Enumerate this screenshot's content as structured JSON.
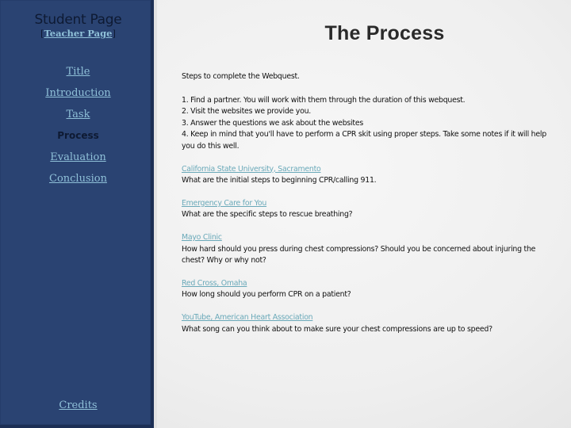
{
  "sidebar": {
    "title": "Student Page",
    "teacher_bracket_open": "[",
    "teacher_link": "Teacher Page",
    "teacher_bracket_close": "]",
    "nav": [
      {
        "label": "Title",
        "current": false
      },
      {
        "label": "Introduction",
        "current": false
      },
      {
        "label": "Task",
        "current": false
      },
      {
        "label": "Process",
        "current": true
      },
      {
        "label": "Evaluation",
        "current": false
      },
      {
        "label": "Conclusion",
        "current": false
      }
    ],
    "credits": "Credits"
  },
  "main": {
    "title": "The Process",
    "intro": "Steps to complete the Webquest.",
    "steps": [
      "1. Find a partner.  You will work with them through the duration of this webquest.",
      "2. Visit the websites we provide you.",
      "3. Answer the questions we ask about the websites",
      "4. Keep in mind that you'll have to perform a CPR skit using proper steps.  Take some notes if it will help you do this well."
    ],
    "resources": [
      {
        "link": "California State University, Sacramento",
        "question": "What are the initial steps to beginning CPR/calling 911."
      },
      {
        "link": "Emergency Care for You",
        "question": "What are the specific steps to rescue breathing?"
      },
      {
        "link": "Mayo Clinic",
        "question": "How hard should you press during chest compressions?  Should you be concerned about injuring the chest?  Why or why not?"
      },
      {
        "link": "Red Cross, Omaha",
        "question": "How long should you perform CPR on a patient?"
      },
      {
        "link": "YouTube, American Heart Association",
        "question": "What song can you think about to make sure your chest compressions are up to speed?"
      }
    ]
  },
  "colors": {
    "sidebar_bg": "#2a4372",
    "sidebar_border": "#1c2f55",
    "sidebar_link": "#8fc0d8",
    "content_link": "#6aa9b9",
    "text": "#111111"
  }
}
